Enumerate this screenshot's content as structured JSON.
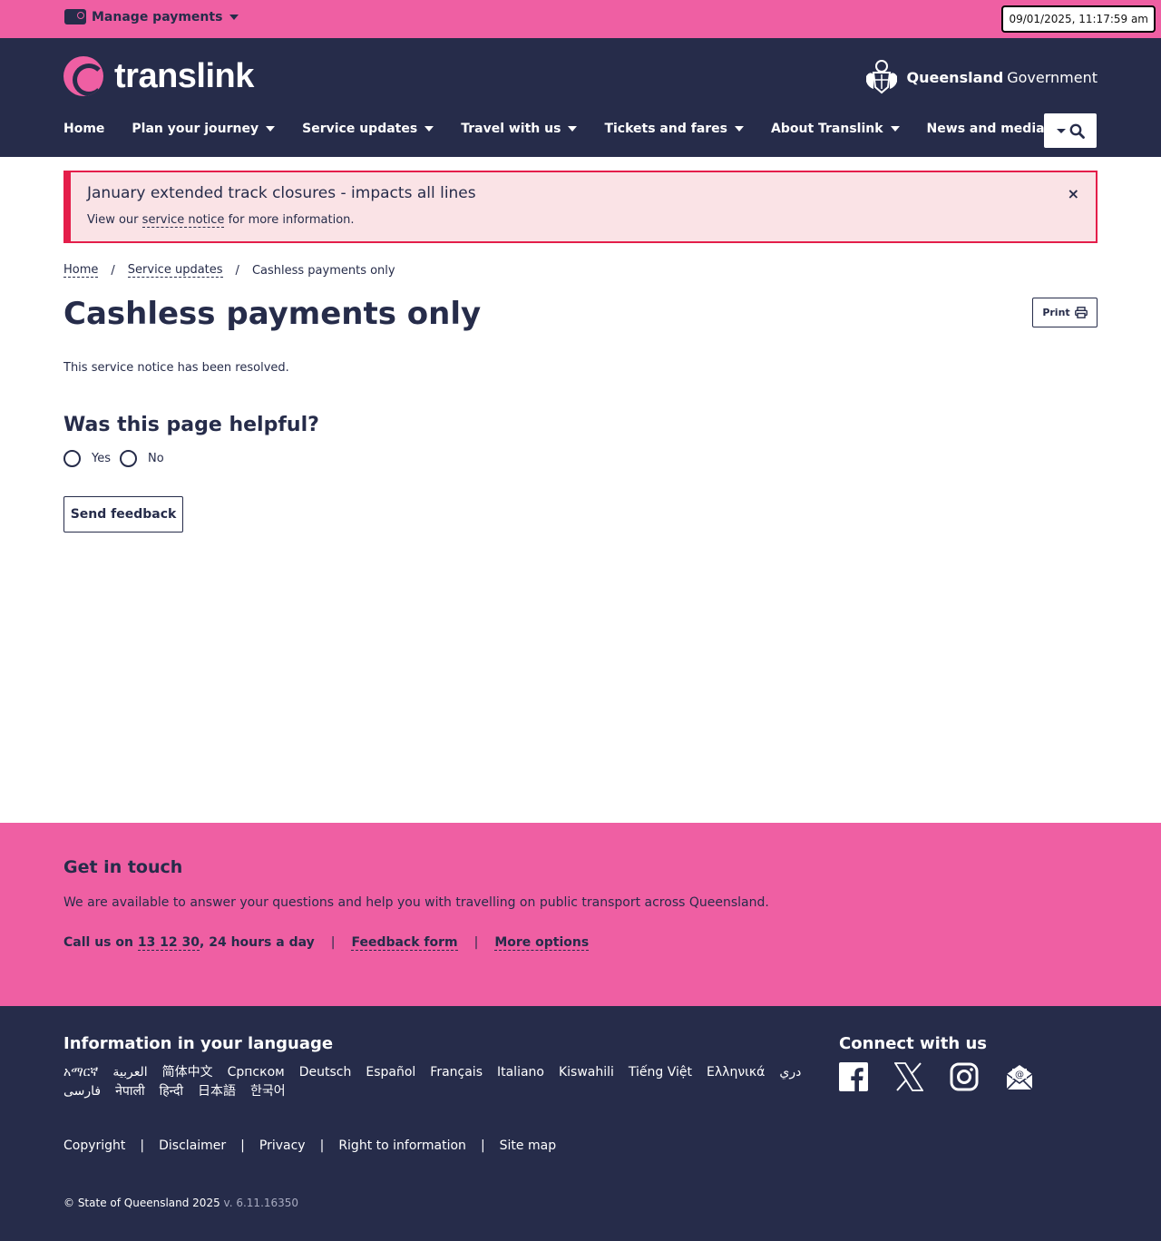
{
  "topbar": {
    "manage_label": "Manage payments",
    "timestamp": "09/01/2025, 11:17:59 am"
  },
  "header": {
    "logo_text": "translink",
    "gov_bold": "Queensland",
    "gov_light": "Government",
    "nav": [
      {
        "label": "Home",
        "has_menu": false
      },
      {
        "label": "Plan your journey",
        "has_menu": true
      },
      {
        "label": "Service updates",
        "has_menu": true
      },
      {
        "label": "Travel with us",
        "has_menu": true
      },
      {
        "label": "Tickets and fares",
        "has_menu": true
      },
      {
        "label": "About Translink",
        "has_menu": true
      },
      {
        "label": "News and media",
        "has_menu": true
      }
    ]
  },
  "alert": {
    "title": "January extended track closures - impacts all lines",
    "body_prefix": "View our",
    "body_link": "service notice",
    "body_suffix": "for more information.",
    "close": "×"
  },
  "breadcrumb": {
    "home": "Home",
    "sep": "/",
    "service_updates": "Service updates",
    "current": "Cashless payments only"
  },
  "page": {
    "title": "Cashless payments only",
    "print_label": "Print",
    "resolved_text": "This service notice has been resolved."
  },
  "feedback": {
    "question": "Was this page helpful?",
    "yes": "Yes",
    "no": "No",
    "send_label": "Send feedback"
  },
  "touch": {
    "title": "Get in touch",
    "text": "We are available to answer your questions and help you with travelling on public transport across Queensland.",
    "call_prefix": "Call us on",
    "call_number": "13 12 30",
    "call_suffix": ", 24 hours a day",
    "pipe": "|",
    "feedback_form": "Feedback form",
    "more_options": "More options"
  },
  "footer": {
    "lang_title": "Information in your language",
    "languages": [
      "አማርኛ",
      "العربية",
      "简体中文",
      "Српском",
      "Deutsch",
      "Español",
      "Français",
      "Italiano",
      "Kiswahili",
      "Tiếng Việt",
      "Ελληνικά",
      "دري",
      "فارسی",
      "नेपाली",
      "हिन्दी",
      "日本語",
      "한국어"
    ],
    "connect_title": "Connect with us",
    "social_icons": [
      "facebook-icon",
      "x-icon",
      "instagram-icon",
      "email-icon"
    ],
    "links": [
      "Copyright",
      "Disclaimer",
      "Privacy",
      "Right to information",
      "Site map"
    ],
    "pipe": "|",
    "copyright": "© State of Queensland 2025",
    "version": "v. 6.11.16350"
  },
  "colors": {
    "pink": "#ef5fa3",
    "navy": "#262c4a",
    "alert_red": "#e41e4a",
    "alert_bg": "#fae3e6"
  }
}
